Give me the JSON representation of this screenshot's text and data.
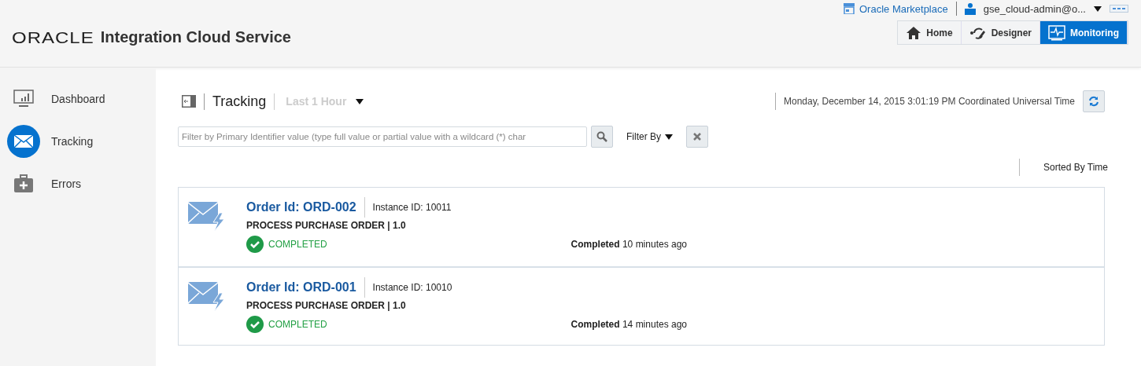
{
  "header": {
    "brand": "ORACLE",
    "product": "Integration Cloud Service",
    "marketplace_link": "Oracle Marketplace",
    "user": "gse_cloud-admin@o...",
    "tabs": [
      {
        "label": "Home",
        "selected": false
      },
      {
        "label": "Designer",
        "selected": false
      },
      {
        "label": "Monitoring",
        "selected": true
      }
    ]
  },
  "sidebar": {
    "items": [
      {
        "label": "Dashboard",
        "selected": false
      },
      {
        "label": "Tracking",
        "selected": true
      },
      {
        "label": "Errors",
        "selected": false
      }
    ]
  },
  "toolbar": {
    "title": "Tracking",
    "range": "Last 1 Hour",
    "timestamp": "Monday, December 14, 2015 3:01:19 PM Coordinated Universal Time"
  },
  "filter": {
    "placeholder": "Filter by Primary Identifier value (type full value or partial value with a wildcard (*) char",
    "filter_by": "Filter By"
  },
  "sort_label": "Sorted By Time",
  "instances": [
    {
      "order": "Order Id: ORD-002",
      "instance": "Instance ID: 10011",
      "integration": "PROCESS PURCHASE ORDER | 1.0",
      "status": {
        "kind": "completed",
        "label": "COMPLETED"
      },
      "time": "**Completed** 10 minutes ago"
    },
    {
      "order": "Order Id: ORD-001",
      "instance": "Instance ID: 10010",
      "integration": "PROCESS PURCHASE ORDER | 1.0",
      "status": {
        "kind": "completed",
        "label": "COMPLETED"
      },
      "time": "**Completed** 14 minutes ago"
    }
  ]
}
